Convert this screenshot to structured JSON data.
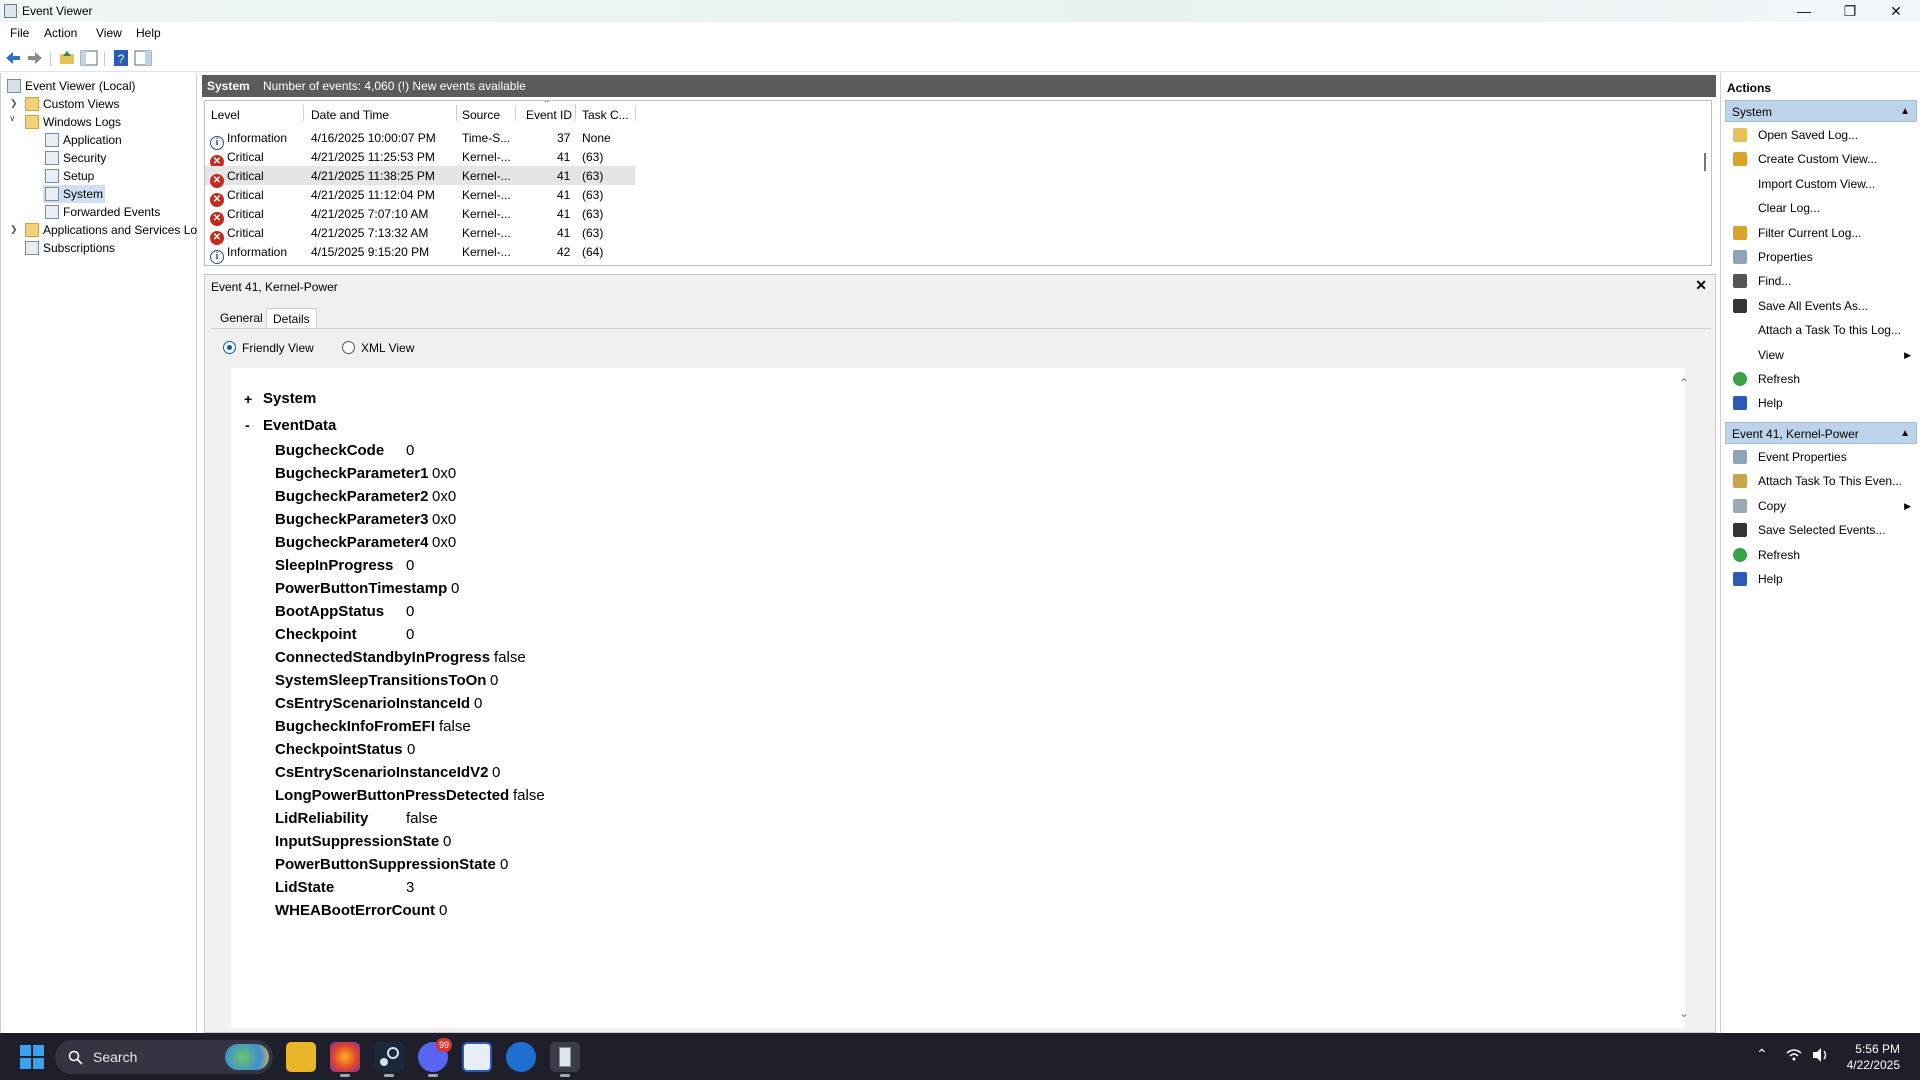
{
  "window": {
    "title": "Event Viewer"
  },
  "menu": [
    "File",
    "Action",
    "View",
    "Help"
  ],
  "tree": {
    "root": "Event Viewer (Local)",
    "custom_views": "Custom Views",
    "windows_logs": "Windows Logs",
    "logs": [
      "Application",
      "Security",
      "Setup",
      "System",
      "Forwarded Events"
    ],
    "apps_services": "Applications and Services Lo",
    "subscriptions": "Subscriptions"
  },
  "center_header": {
    "log_name": "System",
    "summary": "Number of events: 4,060 (!) New events available"
  },
  "grid": {
    "columns": [
      "Level",
      "Date and Time",
      "Source",
      "Event ID",
      "Task C..."
    ],
    "rows": [
      {
        "level": "Information",
        "type": "info",
        "datetime": "4/16/2025 10:00:07 PM",
        "source": "Time-S...",
        "event_id": "37",
        "task": "None"
      },
      {
        "level": "Critical",
        "type": "critical",
        "datetime": "4/21/2025 11:25:53 PM",
        "source": "Kernel-...",
        "event_id": "41",
        "task": "(63)"
      },
      {
        "level": "Critical",
        "type": "critical",
        "datetime": "4/21/2025 11:38:25 PM",
        "source": "Kernel-...",
        "event_id": "41",
        "task": "(63)"
      },
      {
        "level": "Critical",
        "type": "critical",
        "datetime": "4/21/2025 11:12:04 PM",
        "source": "Kernel-...",
        "event_id": "41",
        "task": "(63)"
      },
      {
        "level": "Critical",
        "type": "critical",
        "datetime": "4/21/2025 7:07:10 AM",
        "source": "Kernel-...",
        "event_id": "41",
        "task": "(63)"
      },
      {
        "level": "Critical",
        "type": "critical",
        "datetime": "4/21/2025 7:13:32 AM",
        "source": "Kernel-...",
        "event_id": "41",
        "task": "(63)"
      },
      {
        "level": "Information",
        "type": "info",
        "datetime": "4/15/2025 9:15:20 PM",
        "source": "Kernel-...",
        "event_id": "42",
        "task": "(64)"
      }
    ]
  },
  "detail": {
    "title": "Event 41, Kernel-Power",
    "tabs": [
      "General",
      "Details"
    ],
    "views": [
      "Friendly View",
      "XML View"
    ],
    "tree": {
      "system_toggle": "+",
      "system": "System",
      "eventdata_toggle": "-",
      "eventdata": "EventData",
      "fields": [
        {
          "key": "BugcheckCode",
          "value": "0"
        },
        {
          "key": "BugcheckParameter1",
          "value": "0x0"
        },
        {
          "key": "BugcheckParameter2",
          "value": "0x0"
        },
        {
          "key": "BugcheckParameter3",
          "value": "0x0"
        },
        {
          "key": "BugcheckParameter4",
          "value": "0x0"
        },
        {
          "key": "SleepInProgress",
          "value": "0"
        },
        {
          "key": "PowerButtonTimestamp",
          "value": "0"
        },
        {
          "key": "BootAppStatus",
          "value": "0"
        },
        {
          "key": "Checkpoint",
          "value": "0"
        },
        {
          "key": "ConnectedStandbyInProgress",
          "value": "false"
        },
        {
          "key": "SystemSleepTransitionsToOn",
          "value": "0"
        },
        {
          "key": "CsEntryScenarioInstanceId",
          "value": "0"
        },
        {
          "key": "BugcheckInfoFromEFI",
          "value": "false"
        },
        {
          "key": "CheckpointStatus",
          "value": "0"
        },
        {
          "key": "CsEntryScenarioInstanceIdV2",
          "value": "0"
        },
        {
          "key": "LongPowerButtonPressDetected",
          "value": "false"
        },
        {
          "key": "LidReliability",
          "value": "false"
        },
        {
          "key": "InputSuppressionState",
          "value": "0"
        },
        {
          "key": "PowerButtonSuppressionState",
          "value": "0"
        },
        {
          "key": "LidState",
          "value": "3"
        },
        {
          "key": "WHEABootErrorCount",
          "value": "0"
        }
      ]
    }
  },
  "actions": {
    "title": "Actions",
    "section1": "System",
    "items1": [
      "Open Saved Log...",
      "Create Custom View...",
      "Import Custom View...",
      "Clear Log...",
      "Filter Current Log...",
      "Properties",
      "Find...",
      "Save All Events As...",
      "Attach a Task To this Log...",
      "View",
      "Refresh",
      "Help"
    ],
    "section2": "Event 41, Kernel-Power",
    "items2": [
      "Event Properties",
      "Attach Task To This Even...",
      "Copy",
      "Save Selected Events...",
      "Refresh",
      "Help"
    ]
  },
  "taskbar": {
    "search_placeholder": "Search",
    "time": "5:56 PM",
    "date": "4/22/2025",
    "discord_badge": "99"
  },
  "colors": {
    "accent": "#005fb8",
    "header_bg": "#5b5b5b",
    "actions_header": "#bcd3ea",
    "critical": "#c42b1c",
    "taskbar": "#1f1f2b"
  }
}
